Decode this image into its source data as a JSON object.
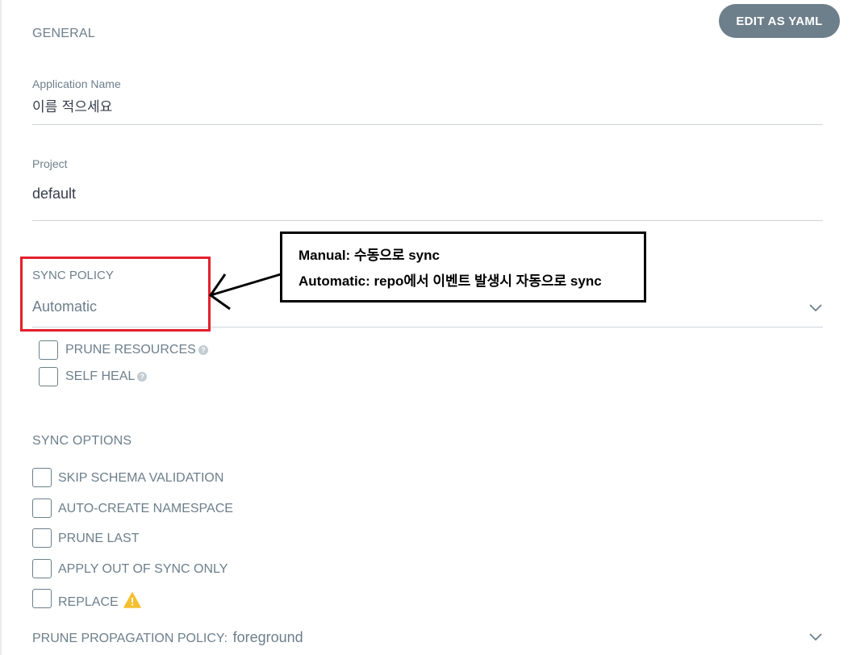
{
  "header": {
    "section_title": "GENERAL",
    "edit_yaml_label": "EDIT AS YAML"
  },
  "general": {
    "app_name_label": "Application Name",
    "app_name_value": "이름 적으세요",
    "project_label": "Project",
    "project_value": "default"
  },
  "sync_policy": {
    "label": "SYNC POLICY",
    "value": "Automatic",
    "options": [
      {
        "label": "PRUNE RESOURCES",
        "checked": false
      },
      {
        "label": "SELF HEAL",
        "checked": false
      }
    ]
  },
  "annotation": {
    "line1": "Manual: 수동으로 sync",
    "line2": "Automatic: repo에서 이벤트 발생시 자동으로 sync",
    "box_color": "#e3202b"
  },
  "sync_options": {
    "title": "SYNC OPTIONS",
    "items": [
      {
        "label": "SKIP SCHEMA VALIDATION",
        "checked": false
      },
      {
        "label": "AUTO-CREATE NAMESPACE",
        "checked": false
      },
      {
        "label": "PRUNE LAST",
        "checked": false
      },
      {
        "label": "APPLY OUT OF SYNC ONLY",
        "checked": false
      },
      {
        "label": "REPLACE",
        "checked": false,
        "icon": "warning-icon"
      }
    ]
  },
  "prune_propagation": {
    "label": "PRUNE PROPAGATION POLICY:",
    "value": "foreground"
  },
  "colors": {
    "accent": "#6d7f8b",
    "warning": "#f4c030"
  }
}
